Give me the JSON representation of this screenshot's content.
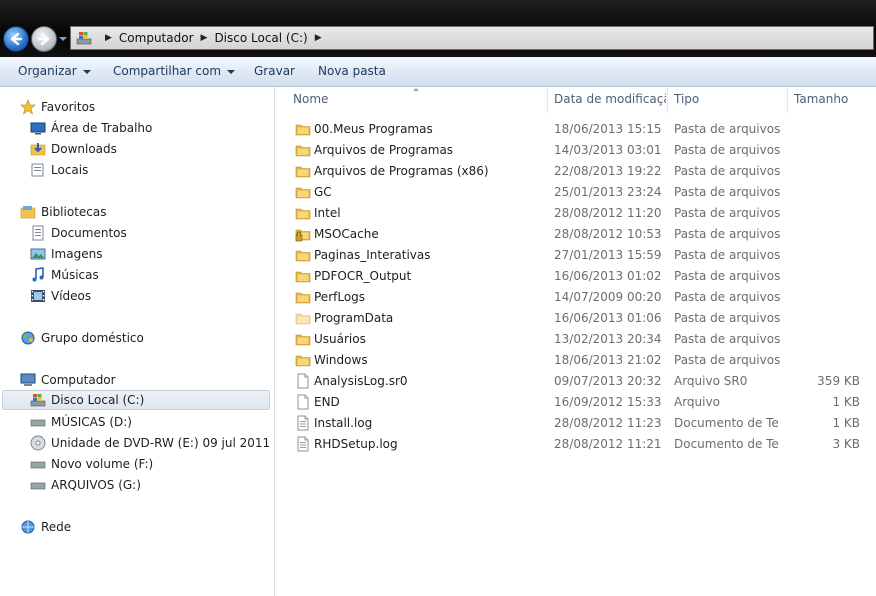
{
  "address": {
    "segments": [
      "Computador",
      "Disco Local (C:)"
    ]
  },
  "toolbar": {
    "organize": "Organizar",
    "share": "Compartilhar com",
    "burn": "Gravar",
    "new_folder": "Nova pasta"
  },
  "navpane": {
    "favorites": {
      "label": "Favoritos",
      "items": [
        "Área de Trabalho",
        "Downloads",
        "Locais"
      ]
    },
    "libraries": {
      "label": "Bibliotecas",
      "items": [
        "Documentos",
        "Imagens",
        "Músicas",
        "Vídeos"
      ]
    },
    "homegroup": "Grupo doméstico",
    "computer": {
      "label": "Computador",
      "items": [
        "Disco Local (C:)",
        "MÚSICAS (D:)",
        "Unidade de DVD-RW (E:) 09 jul 2011",
        "Novo volume (F:)",
        "ARQUIVOS (G:)"
      ]
    },
    "network": "Rede"
  },
  "columns": {
    "name": "Nome",
    "date": "Data de modificaçã...",
    "type": "Tipo",
    "size": "Tamanho"
  },
  "files": [
    {
      "name": "00.Meus Programas",
      "date": "18/06/2013 15:15",
      "type": "Pasta de arquivos",
      "size": "",
      "icon": "folder"
    },
    {
      "name": "Arquivos de Programas",
      "date": "14/03/2013 03:01",
      "type": "Pasta de arquivos",
      "size": "",
      "icon": "folder"
    },
    {
      "name": "Arquivos de Programas (x86)",
      "date": "22/08/2013 19:22",
      "type": "Pasta de arquivos",
      "size": "",
      "icon": "folder"
    },
    {
      "name": "GC",
      "date": "25/01/2013 23:24",
      "type": "Pasta de arquivos",
      "size": "",
      "icon": "folder"
    },
    {
      "name": "Intel",
      "date": "28/08/2012 11:20",
      "type": "Pasta de arquivos",
      "size": "",
      "icon": "folder"
    },
    {
      "name": "MSOCache",
      "date": "28/08/2012 10:53",
      "type": "Pasta de arquivos",
      "size": "",
      "icon": "folder-locked"
    },
    {
      "name": "Paginas_Interativas",
      "date": "27/01/2013 15:59",
      "type": "Pasta de arquivos",
      "size": "",
      "icon": "folder"
    },
    {
      "name": "PDFOCR_Output",
      "date": "16/06/2013 01:02",
      "type": "Pasta de arquivos",
      "size": "",
      "icon": "folder"
    },
    {
      "name": "PerfLogs",
      "date": "14/07/2009 00:20",
      "type": "Pasta de arquivos",
      "size": "",
      "icon": "folder"
    },
    {
      "name": "ProgramData",
      "date": "16/06/2013 01:06",
      "type": "Pasta de arquivos",
      "size": "",
      "icon": "folder-hidden"
    },
    {
      "name": "Usuários",
      "date": "13/02/2013 20:34",
      "type": "Pasta de arquivos",
      "size": "",
      "icon": "folder"
    },
    {
      "name": "Windows",
      "date": "18/06/2013 21:02",
      "type": "Pasta de arquivos",
      "size": "",
      "icon": "folder"
    },
    {
      "name": "AnalysisLog.sr0",
      "date": "09/07/2013 20:32",
      "type": "Arquivo SR0",
      "size": "359 KB",
      "icon": "file"
    },
    {
      "name": "END",
      "date": "16/09/2012 15:33",
      "type": "Arquivo",
      "size": "1 KB",
      "icon": "file"
    },
    {
      "name": "Install.log",
      "date": "28/08/2012 11:23",
      "type": "Documento de Te...",
      "size": "1 KB",
      "icon": "text-file"
    },
    {
      "name": "RHDSetup.log",
      "date": "28/08/2012 11:21",
      "type": "Documento de Te...",
      "size": "3 KB",
      "icon": "text-file"
    }
  ],
  "colors": {
    "accent": "#1e395b",
    "selection": "#dfe6ef",
    "folder": "#f2c34c"
  }
}
